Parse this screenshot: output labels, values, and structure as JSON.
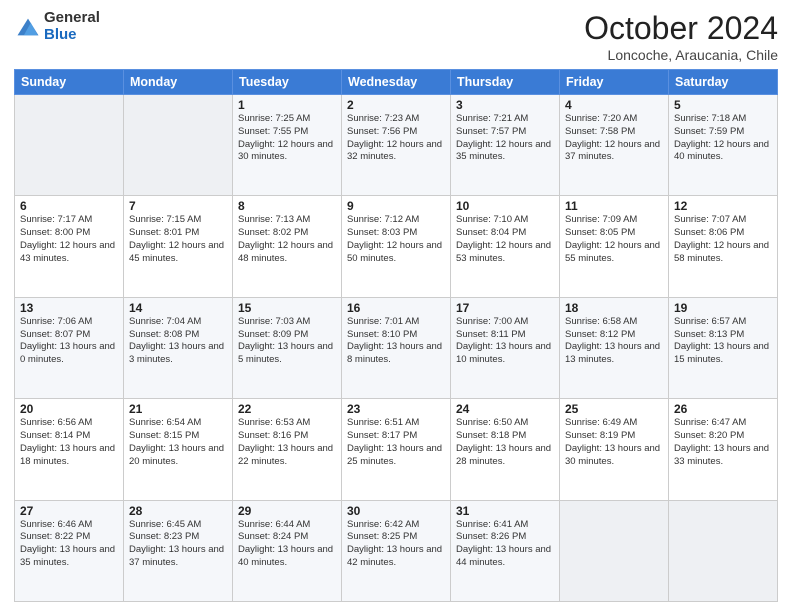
{
  "header": {
    "logo_general": "General",
    "logo_blue": "Blue",
    "month_title": "October 2024",
    "location": "Loncoche, Araucania, Chile"
  },
  "days_of_week": [
    "Sunday",
    "Monday",
    "Tuesday",
    "Wednesday",
    "Thursday",
    "Friday",
    "Saturday"
  ],
  "weeks": [
    [
      {
        "day": "",
        "info": ""
      },
      {
        "day": "",
        "info": ""
      },
      {
        "day": "1",
        "info": "Sunrise: 7:25 AM\nSunset: 7:55 PM\nDaylight: 12 hours and 30 minutes."
      },
      {
        "day": "2",
        "info": "Sunrise: 7:23 AM\nSunset: 7:56 PM\nDaylight: 12 hours and 32 minutes."
      },
      {
        "day": "3",
        "info": "Sunrise: 7:21 AM\nSunset: 7:57 PM\nDaylight: 12 hours and 35 minutes."
      },
      {
        "day": "4",
        "info": "Sunrise: 7:20 AM\nSunset: 7:58 PM\nDaylight: 12 hours and 37 minutes."
      },
      {
        "day": "5",
        "info": "Sunrise: 7:18 AM\nSunset: 7:59 PM\nDaylight: 12 hours and 40 minutes."
      }
    ],
    [
      {
        "day": "6",
        "info": "Sunrise: 7:17 AM\nSunset: 8:00 PM\nDaylight: 12 hours and 43 minutes."
      },
      {
        "day": "7",
        "info": "Sunrise: 7:15 AM\nSunset: 8:01 PM\nDaylight: 12 hours and 45 minutes."
      },
      {
        "day": "8",
        "info": "Sunrise: 7:13 AM\nSunset: 8:02 PM\nDaylight: 12 hours and 48 minutes."
      },
      {
        "day": "9",
        "info": "Sunrise: 7:12 AM\nSunset: 8:03 PM\nDaylight: 12 hours and 50 minutes."
      },
      {
        "day": "10",
        "info": "Sunrise: 7:10 AM\nSunset: 8:04 PM\nDaylight: 12 hours and 53 minutes."
      },
      {
        "day": "11",
        "info": "Sunrise: 7:09 AM\nSunset: 8:05 PM\nDaylight: 12 hours and 55 minutes."
      },
      {
        "day": "12",
        "info": "Sunrise: 7:07 AM\nSunset: 8:06 PM\nDaylight: 12 hours and 58 minutes."
      }
    ],
    [
      {
        "day": "13",
        "info": "Sunrise: 7:06 AM\nSunset: 8:07 PM\nDaylight: 13 hours and 0 minutes."
      },
      {
        "day": "14",
        "info": "Sunrise: 7:04 AM\nSunset: 8:08 PM\nDaylight: 13 hours and 3 minutes."
      },
      {
        "day": "15",
        "info": "Sunrise: 7:03 AM\nSunset: 8:09 PM\nDaylight: 13 hours and 5 minutes."
      },
      {
        "day": "16",
        "info": "Sunrise: 7:01 AM\nSunset: 8:10 PM\nDaylight: 13 hours and 8 minutes."
      },
      {
        "day": "17",
        "info": "Sunrise: 7:00 AM\nSunset: 8:11 PM\nDaylight: 13 hours and 10 minutes."
      },
      {
        "day": "18",
        "info": "Sunrise: 6:58 AM\nSunset: 8:12 PM\nDaylight: 13 hours and 13 minutes."
      },
      {
        "day": "19",
        "info": "Sunrise: 6:57 AM\nSunset: 8:13 PM\nDaylight: 13 hours and 15 minutes."
      }
    ],
    [
      {
        "day": "20",
        "info": "Sunrise: 6:56 AM\nSunset: 8:14 PM\nDaylight: 13 hours and 18 minutes."
      },
      {
        "day": "21",
        "info": "Sunrise: 6:54 AM\nSunset: 8:15 PM\nDaylight: 13 hours and 20 minutes."
      },
      {
        "day": "22",
        "info": "Sunrise: 6:53 AM\nSunset: 8:16 PM\nDaylight: 13 hours and 22 minutes."
      },
      {
        "day": "23",
        "info": "Sunrise: 6:51 AM\nSunset: 8:17 PM\nDaylight: 13 hours and 25 minutes."
      },
      {
        "day": "24",
        "info": "Sunrise: 6:50 AM\nSunset: 8:18 PM\nDaylight: 13 hours and 28 minutes."
      },
      {
        "day": "25",
        "info": "Sunrise: 6:49 AM\nSunset: 8:19 PM\nDaylight: 13 hours and 30 minutes."
      },
      {
        "day": "26",
        "info": "Sunrise: 6:47 AM\nSunset: 8:20 PM\nDaylight: 13 hours and 33 minutes."
      }
    ],
    [
      {
        "day": "27",
        "info": "Sunrise: 6:46 AM\nSunset: 8:22 PM\nDaylight: 13 hours and 35 minutes."
      },
      {
        "day": "28",
        "info": "Sunrise: 6:45 AM\nSunset: 8:23 PM\nDaylight: 13 hours and 37 minutes."
      },
      {
        "day": "29",
        "info": "Sunrise: 6:44 AM\nSunset: 8:24 PM\nDaylight: 13 hours and 40 minutes."
      },
      {
        "day": "30",
        "info": "Sunrise: 6:42 AM\nSunset: 8:25 PM\nDaylight: 13 hours and 42 minutes."
      },
      {
        "day": "31",
        "info": "Sunrise: 6:41 AM\nSunset: 8:26 PM\nDaylight: 13 hours and 44 minutes."
      },
      {
        "day": "",
        "info": ""
      },
      {
        "day": "",
        "info": ""
      }
    ]
  ]
}
